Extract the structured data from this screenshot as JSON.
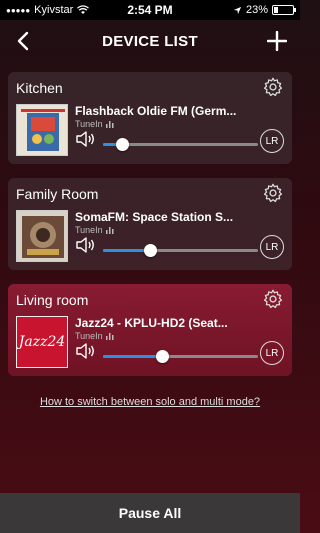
{
  "status_bar": {
    "carrier": "Kyivstar",
    "time": "2:54 PM",
    "battery": "23%",
    "battery_level": 0.23
  },
  "nav": {
    "title": "DEVICE LIST"
  },
  "devices": [
    {
      "room": "Kitchen",
      "station": "Flashback Oldie FM (Germ...",
      "source": "TuneIn",
      "volume": 0.12,
      "mode": "LR",
      "active": false
    },
    {
      "room": "Family Room",
      "station": "SomaFM: Space Station S...",
      "source": "TuneIn",
      "volume": 0.3,
      "mode": "LR",
      "active": false
    },
    {
      "room": "Living room",
      "station": "Jazz24 - KPLU-HD2 (Seat...",
      "source": "TuneIn",
      "volume": 0.38,
      "mode": "LR",
      "active": true,
      "art_text": "Jazz24"
    }
  ],
  "help_link": "How to switch between solo and multi mode?",
  "pause_all": "Pause All",
  "colors": {
    "accent": "#2f8fe0",
    "active_card": "#961e37"
  }
}
